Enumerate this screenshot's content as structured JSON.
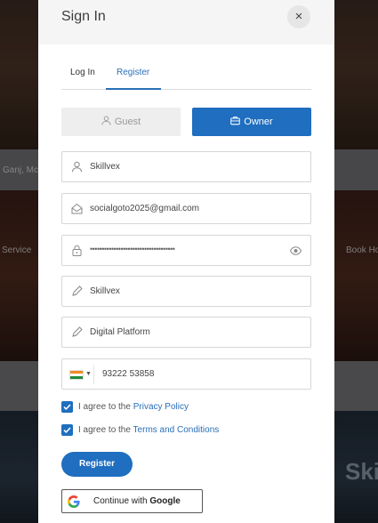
{
  "background": {
    "location_snippet": "Ganj, Mc",
    "service_label": "Service",
    "book_label": "Book Ho",
    "brand_fragment": "Skil"
  },
  "modal": {
    "title": "Sign In",
    "close_symbol": "×"
  },
  "tabs": [
    {
      "label": "Log In",
      "active": false
    },
    {
      "label": "Register",
      "active": true
    }
  ],
  "roles": {
    "guest_label": "Guest",
    "owner_label": "Owner",
    "selected": "Owner"
  },
  "form": {
    "name": "Skillvex",
    "email": "socialgoto2025@gmail.com",
    "password_mask": "••••••••••••••••••••••••••••••••••••",
    "company": "Skillvex",
    "business_type": "Digital Platform",
    "phone_country_icon": "india-flag",
    "phone": "93222 53858"
  },
  "agreements": {
    "privacy_prefix": "I agree to the",
    "privacy_link": "Privacy Policy",
    "terms_prefix": "I agree to the",
    "terms_link": "Terms and Conditions",
    "privacy_checked": true,
    "terms_checked": true
  },
  "actions": {
    "register_label": "Register",
    "google_prefix": "Continue with",
    "google_brand": "Google"
  },
  "colors": {
    "accent": "#1f6ec0",
    "link": "#2a6fb6"
  }
}
